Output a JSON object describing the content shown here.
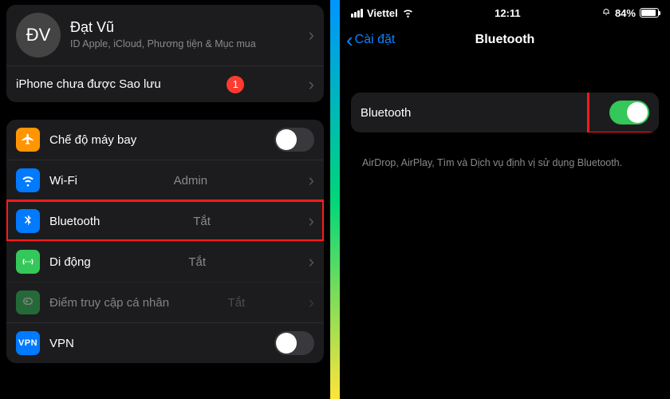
{
  "left": {
    "profile": {
      "initials": "ĐV",
      "name": "Đạt Vũ",
      "subtitle": "ID Apple, iCloud, Phương tiện & Mục mua"
    },
    "backup": {
      "text": "iPhone chưa được Sao lưu",
      "badge": "1"
    },
    "items": [
      {
        "label": "Chế độ máy bay",
        "type": "toggle",
        "on": false,
        "iconColor": "#ff9500",
        "name": "airplane"
      },
      {
        "label": "Wi-Fi",
        "type": "detail",
        "value": "Admin",
        "iconColor": "#007aff",
        "name": "wifi"
      },
      {
        "label": "Bluetooth",
        "type": "detail",
        "value": "Tắt",
        "iconColor": "#007aff",
        "highlight": true,
        "name": "bluetooth"
      },
      {
        "label": "Di động",
        "type": "detail",
        "value": "Tắt",
        "iconColor": "#34c759",
        "name": "cellular"
      },
      {
        "label": "Điểm truy cập cá nhân",
        "type": "detail",
        "value": "Tắt",
        "iconColor": "#34c759",
        "dim": true,
        "name": "hotspot"
      },
      {
        "label": "VPN",
        "type": "toggle",
        "on": false,
        "iconColor": "#007aff",
        "name": "vpn"
      }
    ]
  },
  "right": {
    "status": {
      "carrier": "Viettel",
      "time": "12:11",
      "battery": "84%"
    },
    "back": "Cài đặt",
    "title": "Bluetooth",
    "row": {
      "label": "Bluetooth",
      "on": true
    },
    "description": "AirDrop, AirPlay, Tìm và Dịch vụ định vị sử dụng Bluetooth."
  }
}
